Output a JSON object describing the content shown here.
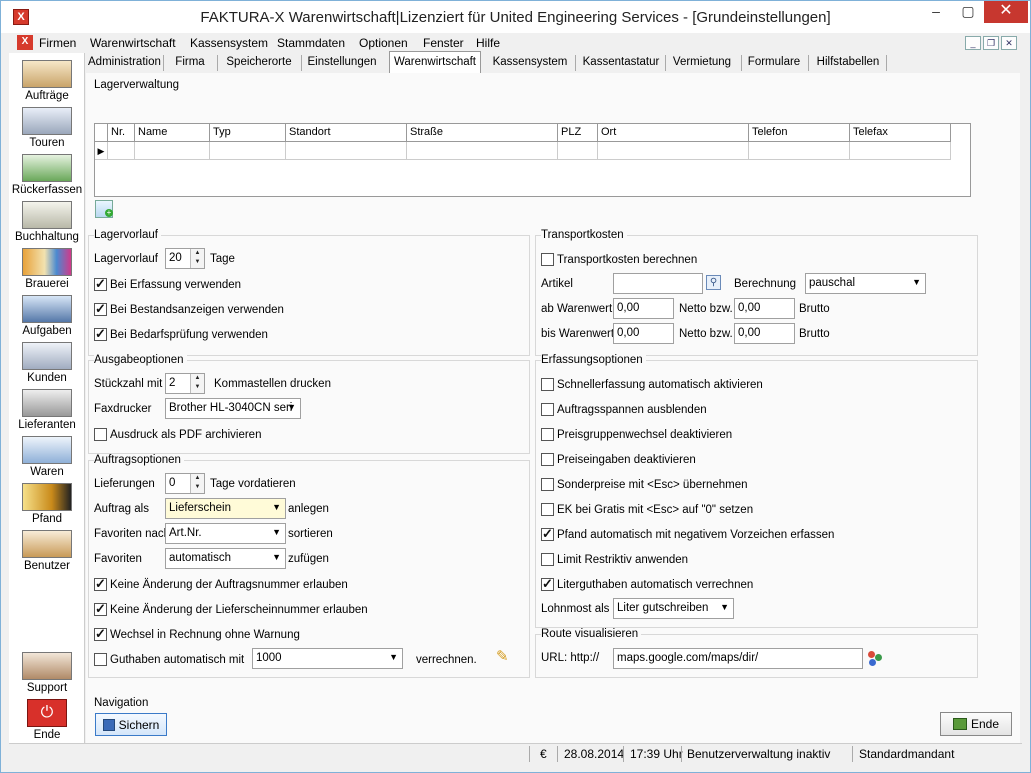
{
  "window": {
    "title": "FAKTURA-X Warenwirtschaft|Lizenziert für United Engineering Services - [Grundeinstellungen]",
    "app_icon": "x-icon",
    "accent": "#c42b1c"
  },
  "menubar": [
    "Firmen",
    "Warenwirtschaft",
    "Kassensystem",
    "Stammdaten",
    "Optionen",
    "Fenster",
    "Hilfe"
  ],
  "sidebar": {
    "items": [
      "Aufträge",
      "Touren",
      "Rückerfassen",
      "Buchhaltung",
      "Brauerei",
      "Aufgaben",
      "Kunden",
      "Lieferanten",
      "Waren",
      "Pfand",
      "Benutzer"
    ],
    "bottom": [
      "Support",
      "Ende"
    ]
  },
  "tabs": [
    "Administration",
    "Firma",
    "Speicherorte",
    "Einstellungen",
    "Warenwirtschaft",
    "Kassensystem",
    "Kassentastatur",
    "Vermietung",
    "Formulare",
    "Hilfstabellen"
  ],
  "active_tab": "Warenwirtschaft",
  "lagerverwaltung": {
    "label": "Lagerverwaltung",
    "columns": [
      "Nr.",
      "Name",
      "Typ",
      "Standort",
      "Straße",
      "PLZ",
      "Ort",
      "Telefon",
      "Telefax"
    ]
  },
  "lagervorlauf": {
    "label": "Lagervorlauf",
    "field_label": "Lagervorlauf",
    "value": "20",
    "unit": "Tage",
    "checks": [
      {
        "label": "Bei Erfassung verwenden",
        "checked": true
      },
      {
        "label": "Bei Bestandsanzeigen verwenden",
        "checked": true
      },
      {
        "label": "Bei Bedarfsprüfung verwenden",
        "checked": true
      }
    ]
  },
  "ausgabeoptionen": {
    "label": "Ausgabeoptionen",
    "stueck_label": "Stückzahl mit",
    "stueck_value": "2",
    "stueck_suffix": "Kommastellen drucken",
    "fax_label": "Faxdrucker",
    "fax_value": "Brother HL-3040CN seri",
    "pdf_label": "Ausdruck als PDF archivieren",
    "pdf_checked": false
  },
  "auftragsoptionen": {
    "label": "Auftragsoptionen",
    "lief_label": "Lieferungen",
    "lief_value": "0",
    "lief_suffix": "Tage vordatieren",
    "auftrag_label": "Auftrag als",
    "auftrag_value": "Lieferschein",
    "auftrag_suffix": "anlegen",
    "fav_label": "Favoriten nach",
    "fav_value": "Art.Nr.",
    "fav_suffix": "sortieren",
    "fav2_label": "Favoriten",
    "fav2_value": "automatisch",
    "fav2_suffix": "zufügen",
    "checks": [
      {
        "label": "Keine Änderung der Auftragsnummer erlauben",
        "checked": true
      },
      {
        "label": "Keine Änderung der Lieferscheinnummer erlauben",
        "checked": true
      },
      {
        "label": "Wechsel in Rechnung ohne Warnung",
        "checked": true
      }
    ],
    "guthaben_label": "Guthaben automatisch mit",
    "guthaben_checked": false,
    "guthaben_value": "1000",
    "guthaben_suffix": "verrechnen."
  },
  "transportkosten": {
    "label": "Transportkosten",
    "berechnen_label": "Transportkosten berechnen",
    "berechnen_checked": false,
    "artikel_label": "Artikel",
    "artikel_value": "",
    "berechnung_label": "Berechnung",
    "berechnung_value": "pauschal",
    "ab_label": "ab Warenwert",
    "ab_value": "0,00",
    "netto_label": "Netto bzw.",
    "ab_brutto": "0,00",
    "brutto_label": "Brutto",
    "bis_label": "bis Warenwert",
    "bis_value": "0,00",
    "bis_brutto": "0,00"
  },
  "erfassungsoptionen": {
    "label": "Erfassungsoptionen",
    "checks": [
      {
        "label": "Schnellerfassung automatisch aktivieren",
        "checked": false
      },
      {
        "label": "Auftragsspannen ausblenden",
        "checked": false
      },
      {
        "label": "Preisgruppenwechsel deaktivieren",
        "checked": false
      },
      {
        "label": "Preiseingaben deaktivieren",
        "checked": false
      },
      {
        "label": "Sonderpreise mit <Esc> übernehmen",
        "checked": false
      },
      {
        "label": "EK bei Gratis mit <Esc> auf \"0\" setzen",
        "checked": false
      },
      {
        "label": "Pfand automatisch mit negativem Vorzeichen erfassen",
        "checked": true
      },
      {
        "label": "Limit Restriktiv anwenden",
        "checked": false
      },
      {
        "label": "Literguthaben automatisch verrechnen",
        "checked": true
      }
    ],
    "lohnmost_label": "Lohnmost als",
    "lohnmost_value": "Liter gutschreiben"
  },
  "route": {
    "label": "Route visualisieren",
    "url_label": "URL: http://",
    "url_value": "maps.google.com/maps/dir/"
  },
  "navigation": {
    "label": "Navigation",
    "save_label": "Sichern",
    "end_label": "Ende"
  },
  "statusbar": {
    "currency": "€",
    "date": "28.08.2014",
    "time": "17:39 Uhr",
    "user_status": "Benutzerverwaltung inaktiv",
    "mandant": "Standardmandant"
  }
}
